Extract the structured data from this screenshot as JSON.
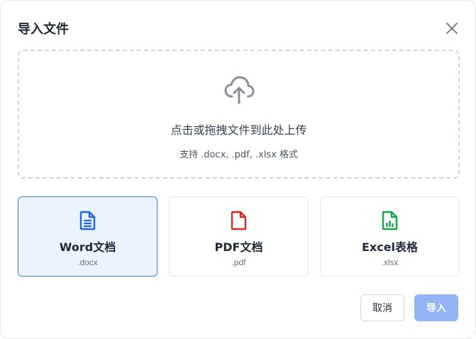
{
  "dialog": {
    "title": "导入文件",
    "close_icon": "close-icon"
  },
  "dropzone": {
    "icon": "cloud-upload-icon",
    "text": "点击或拖拽文件到此处上传",
    "hint": "支持 .docx, .pdf, .xlsx 格式"
  },
  "file_types": [
    {
      "name": "Word文档",
      "ext": ".docx",
      "icon": "word-file-icon",
      "color": "#2563eb",
      "selected": true
    },
    {
      "name": "PDF文档",
      "ext": ".pdf",
      "icon": "pdf-file-icon",
      "color": "#dc2626",
      "selected": false
    },
    {
      "name": "Excel表格",
      "ext": ".xlsx",
      "icon": "excel-file-icon",
      "color": "#16a34a",
      "selected": false
    }
  ],
  "footer": {
    "cancel_label": "取消",
    "import_label": "导入"
  },
  "colors": {
    "selected_border": "#3b82c4",
    "selected_bg": "#ebf3fe",
    "import_button_disabled": "#93b4f5"
  }
}
